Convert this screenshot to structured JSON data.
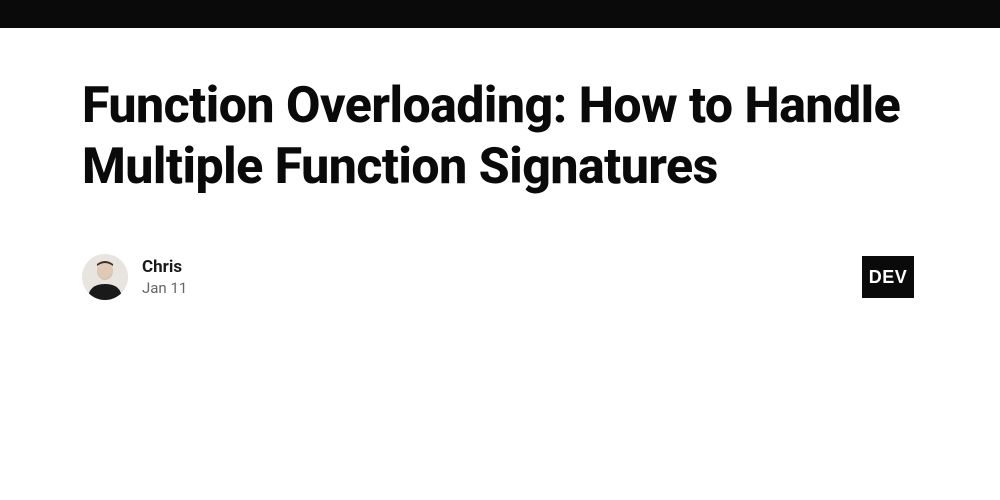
{
  "article": {
    "title": "Function Overloading: How to Handle Multiple Function Signatures"
  },
  "author": {
    "name": "Chris",
    "date": "Jan 11"
  },
  "brand": {
    "badge": "DEV"
  }
}
